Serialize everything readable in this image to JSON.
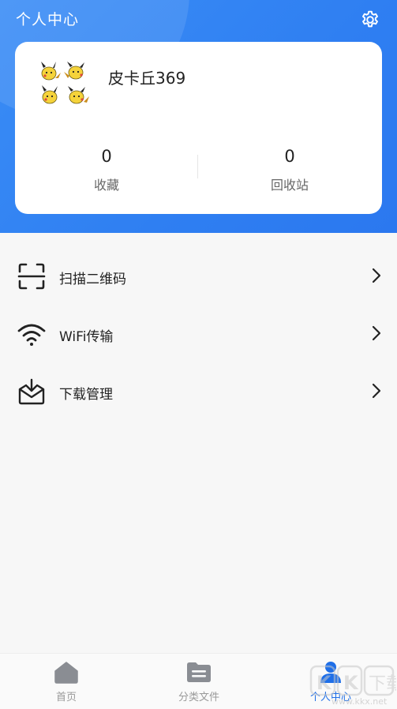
{
  "header": {
    "title": "个人中心"
  },
  "profile": {
    "username": "皮卡丘369",
    "stats": [
      {
        "value": "0",
        "label": "收藏"
      },
      {
        "value": "0",
        "label": "回收站"
      }
    ]
  },
  "menu": {
    "items": [
      {
        "label": "扫描二维码",
        "icon": "scan-qr-icon"
      },
      {
        "label": "WiFi传输",
        "icon": "wifi-icon"
      },
      {
        "label": "下载管理",
        "icon": "download-tray-icon"
      }
    ]
  },
  "tabbar": {
    "items": [
      {
        "label": "首页",
        "icon": "home-icon"
      },
      {
        "label": "分类文件",
        "icon": "folder-icon"
      },
      {
        "label": "个人中心",
        "icon": "user-icon",
        "active": true
      }
    ]
  },
  "watermark": {
    "text": "KK下载",
    "url": "www.kkx.net"
  },
  "colors": {
    "accent": "#2f7ff2",
    "active_tab": "#1f6fe8",
    "inactive_tab": "#999999"
  }
}
